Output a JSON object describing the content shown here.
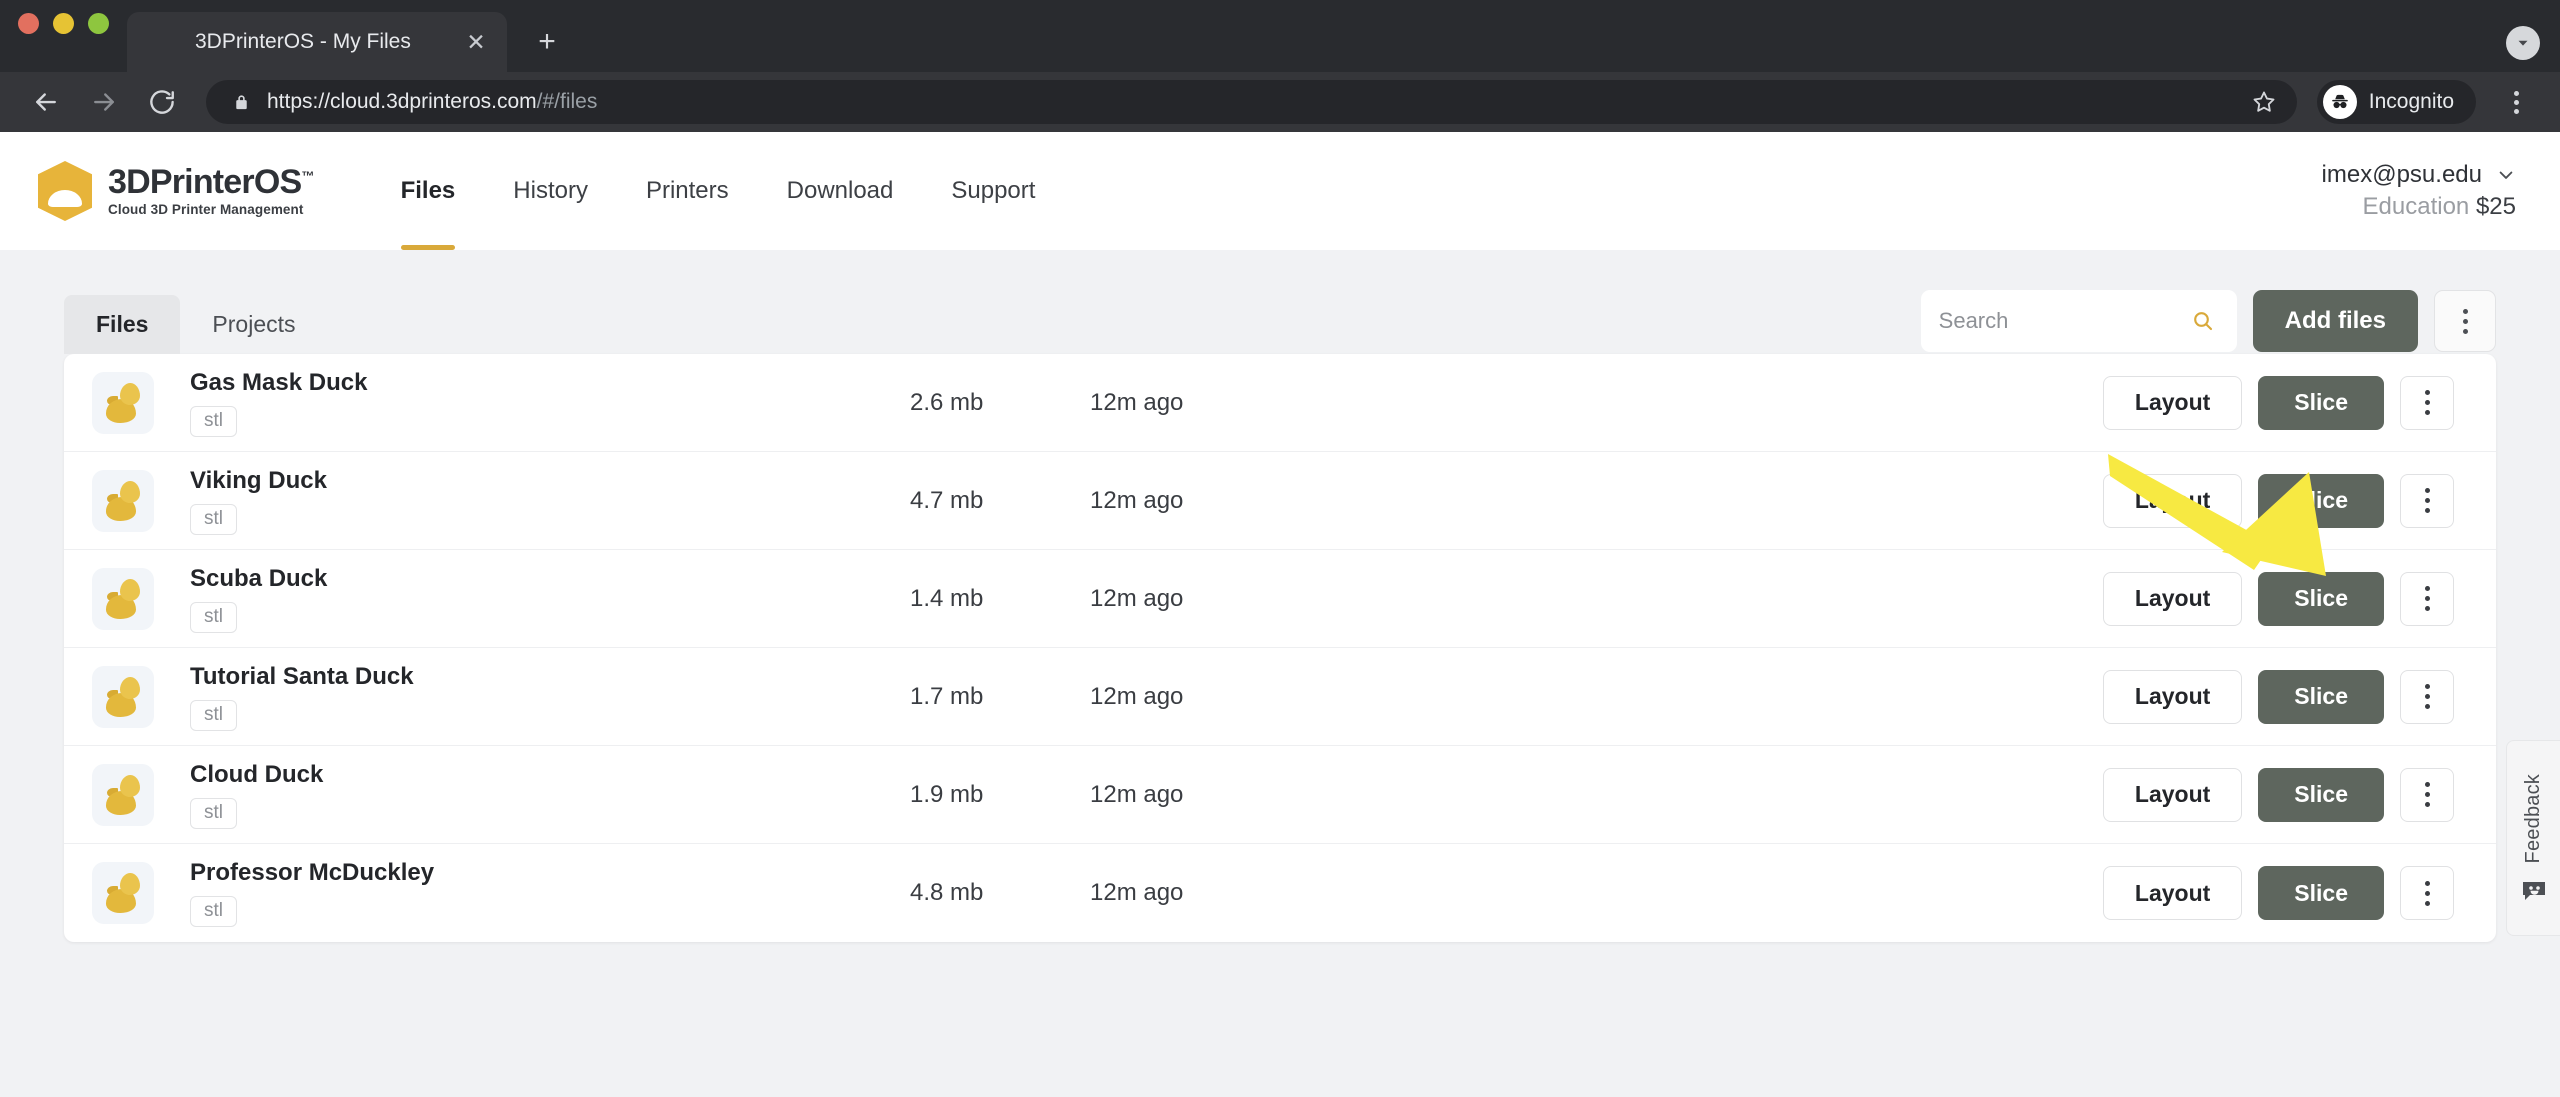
{
  "browser": {
    "traffic_lights": [
      "close",
      "minimize",
      "maximize"
    ],
    "tab": {
      "title": "3DPrinterOS - My Files",
      "favicon": "3dprinteros-hexagon-cloud-icon",
      "close_label": "✕"
    },
    "new_tab_label": "+",
    "nav": {
      "back": "back-arrow-icon",
      "forward": "forward-arrow-icon",
      "reload": "reload-icon"
    },
    "address": {
      "lock": "lock-icon",
      "url_strong": "https://cloud.3dprinteros.com",
      "url_dim": "/#/files",
      "bookmark": "star-icon"
    },
    "profile": {
      "label": "Incognito",
      "icon": "incognito-hat-glasses-icon"
    },
    "menu": "browser-kebab-menu",
    "downloads_chevron": "chevron-down-icon"
  },
  "site": {
    "brand": {
      "name": "3DPrinterOS",
      "tm": "™",
      "tagline": "Cloud 3D Printer Management",
      "logo": "hexagon-cloud-logo"
    },
    "nav_items": [
      {
        "label": "Files",
        "active": true
      },
      {
        "label": "History",
        "active": false
      },
      {
        "label": "Printers",
        "active": false
      },
      {
        "label": "Download",
        "active": false
      },
      {
        "label": "Support",
        "active": false
      }
    ],
    "account": {
      "email": "imex@psu.edu",
      "plan": "Education",
      "balance": "$25",
      "chevron": "chevron-down-icon"
    }
  },
  "toolbar": {
    "subtabs": [
      {
        "label": "Files",
        "active": true
      },
      {
        "label": "Projects",
        "active": false
      }
    ],
    "search": {
      "value": "",
      "placeholder": "Search",
      "icon": "search-icon"
    },
    "add_files_label": "Add files",
    "overflow_menu": "toolbar-kebab-menu"
  },
  "files": {
    "row_actions": {
      "layout_label": "Layout",
      "slice_label": "Slice",
      "menu": "row-kebab-menu"
    },
    "rows": [
      {
        "name": "Gas Mask Duck",
        "type": "stl",
        "size": "2.6 mb",
        "modified": "12m ago"
      },
      {
        "name": "Viking Duck",
        "type": "stl",
        "size": "4.7 mb",
        "modified": "12m ago"
      },
      {
        "name": "Scuba Duck",
        "type": "stl",
        "size": "1.4 mb",
        "modified": "12m ago"
      },
      {
        "name": "Tutorial Santa Duck",
        "type": "stl",
        "size": "1.7 mb",
        "modified": "12m ago"
      },
      {
        "name": "Cloud Duck",
        "type": "stl",
        "size": "1.9 mb",
        "modified": "12m ago"
      },
      {
        "name": "Professor McDuckley",
        "type": "stl",
        "size": "4.8 mb",
        "modified": "12m ago"
      }
    ]
  },
  "feedback": {
    "label": "Feedback",
    "icon": "smiley-speech-bubble-icon"
  },
  "annotation": {
    "type": "arrow",
    "color": "#f7e942",
    "points_to": "Add files"
  },
  "colors": {
    "brand_gold": "#e7b43a",
    "accent_underline": "#d9a93a",
    "button_dark": "#5e665e",
    "page_background": "#f1f2f4",
    "chrome_dark": "#35363a",
    "annotation_yellow": "#f7e942"
  }
}
